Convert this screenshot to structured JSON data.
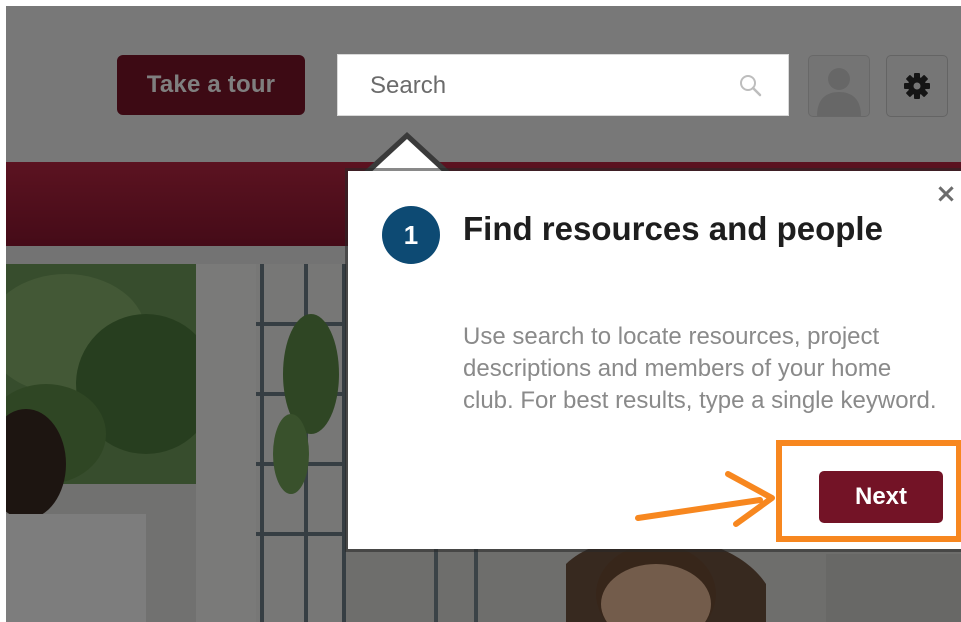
{
  "header": {
    "tour_label": "Take a tour",
    "search_placeholder": "Search"
  },
  "popover": {
    "step": "1",
    "title": "Find resources and people",
    "body": "Use search to locate resources, project descriptions and members of your home club. For best results, type a single keyword.",
    "close_label": "×",
    "next_label": "Next"
  },
  "icons": {
    "search": "search-icon",
    "avatar": "user-avatar-icon",
    "gear": "gear-icon",
    "close": "close-icon"
  },
  "colors": {
    "brand": "#7a1428",
    "nav_bar": "#a01d38",
    "step_badge": "#0d4a73",
    "annotation": "#f7871f"
  }
}
